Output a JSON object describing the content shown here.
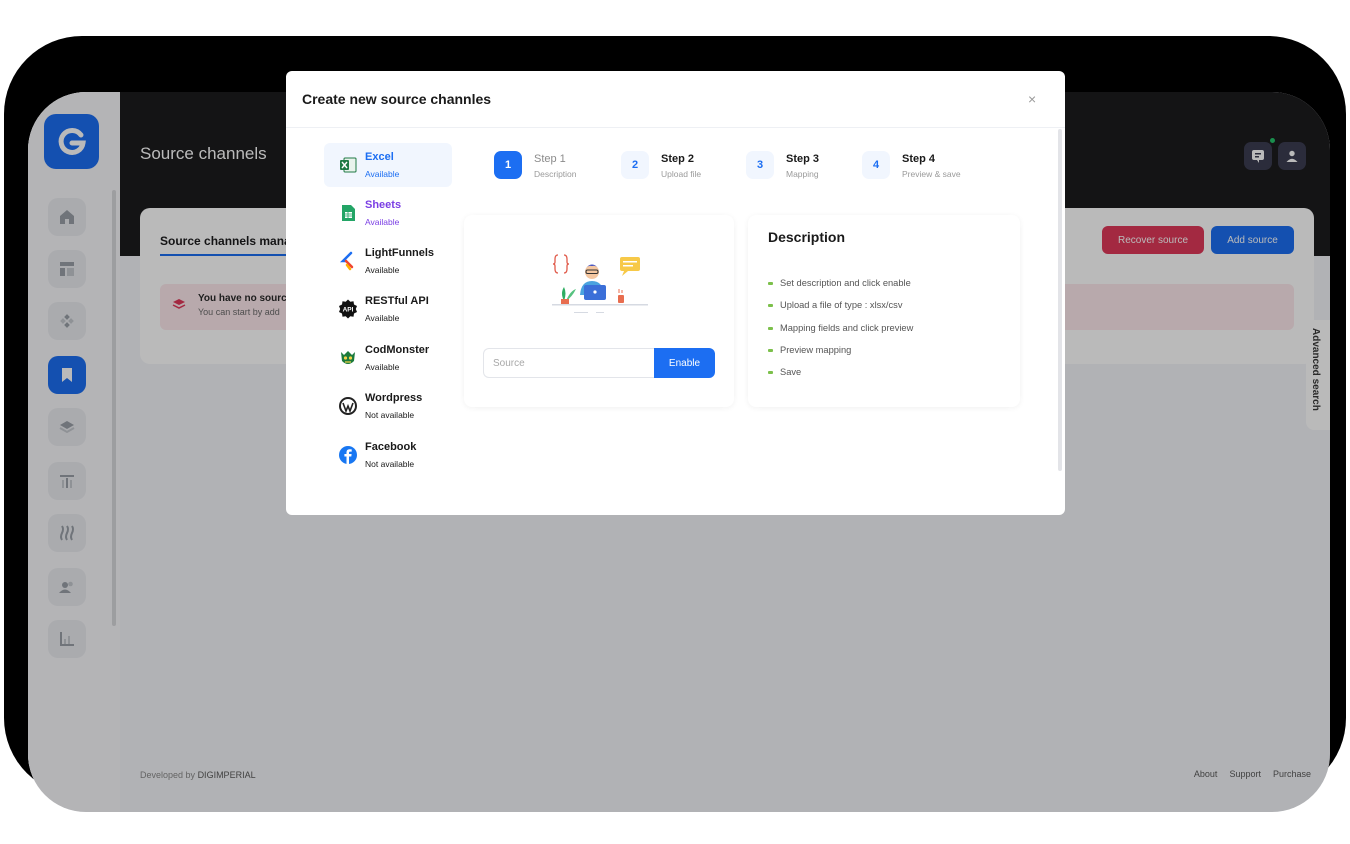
{
  "app": {
    "logo_letter": "G"
  },
  "header": {
    "title": "Source channels"
  },
  "sidebar": {
    "items": [
      {
        "icon": "home-icon"
      },
      {
        "icon": "layout-icon"
      },
      {
        "icon": "apps-icon"
      },
      {
        "icon": "bookmark-icon",
        "active": true
      },
      {
        "icon": "layers-icon"
      },
      {
        "icon": "filter-icon"
      },
      {
        "icon": "waves-icon"
      },
      {
        "icon": "users-icon"
      },
      {
        "icon": "chart-icon"
      }
    ]
  },
  "content": {
    "tab_label": "Source channels mana",
    "alert_title": "You have no sourc",
    "alert_sub": "You can start by add",
    "recover_button": "Recover source",
    "add_button": "Add source",
    "advanced_search": "Advanced search"
  },
  "footer": {
    "developed_by": "Developed by",
    "company": "DIGIMPERIAL",
    "links": [
      "About",
      "Support",
      "Purchase"
    ]
  },
  "modal": {
    "title": "Create new source channles",
    "close_glyph": "×",
    "sources": [
      {
        "name": "Excel",
        "status": "Available"
      },
      {
        "name": "Sheets",
        "status": "Available"
      },
      {
        "name": "LightFunnels",
        "status": "Available"
      },
      {
        "name": "RESTful API",
        "status": "Available"
      },
      {
        "name": "CodMonster",
        "status": "Available"
      },
      {
        "name": "Wordpress",
        "status": "Not available"
      },
      {
        "name": "Facebook",
        "status": "Not available"
      }
    ],
    "steps": [
      {
        "number": "1",
        "title": "Step 1",
        "subtitle": "Description"
      },
      {
        "number": "2",
        "title": "Step 2",
        "subtitle": "Upload file"
      },
      {
        "number": "3",
        "title": "Step 3",
        "subtitle": "Mapping"
      },
      {
        "number": "4",
        "title": "Step 4",
        "subtitle": "Preview & save"
      }
    ],
    "source_input": {
      "placeholder": "Source",
      "value": ""
    },
    "enable_button": "Enable",
    "description": {
      "title": "Description",
      "items": [
        "Set description and click enable",
        "Upload a file of type : xlsx/csv",
        "Mapping fields and click preview",
        "Preview mapping",
        "Save"
      ]
    }
  },
  "colors": {
    "accent": "#1c6ef2",
    "danger": "#e0395a",
    "sheets_purple": "#7b3fe4",
    "bullet_green": "#7cc04b",
    "header_dark": "#1c1c1e"
  }
}
